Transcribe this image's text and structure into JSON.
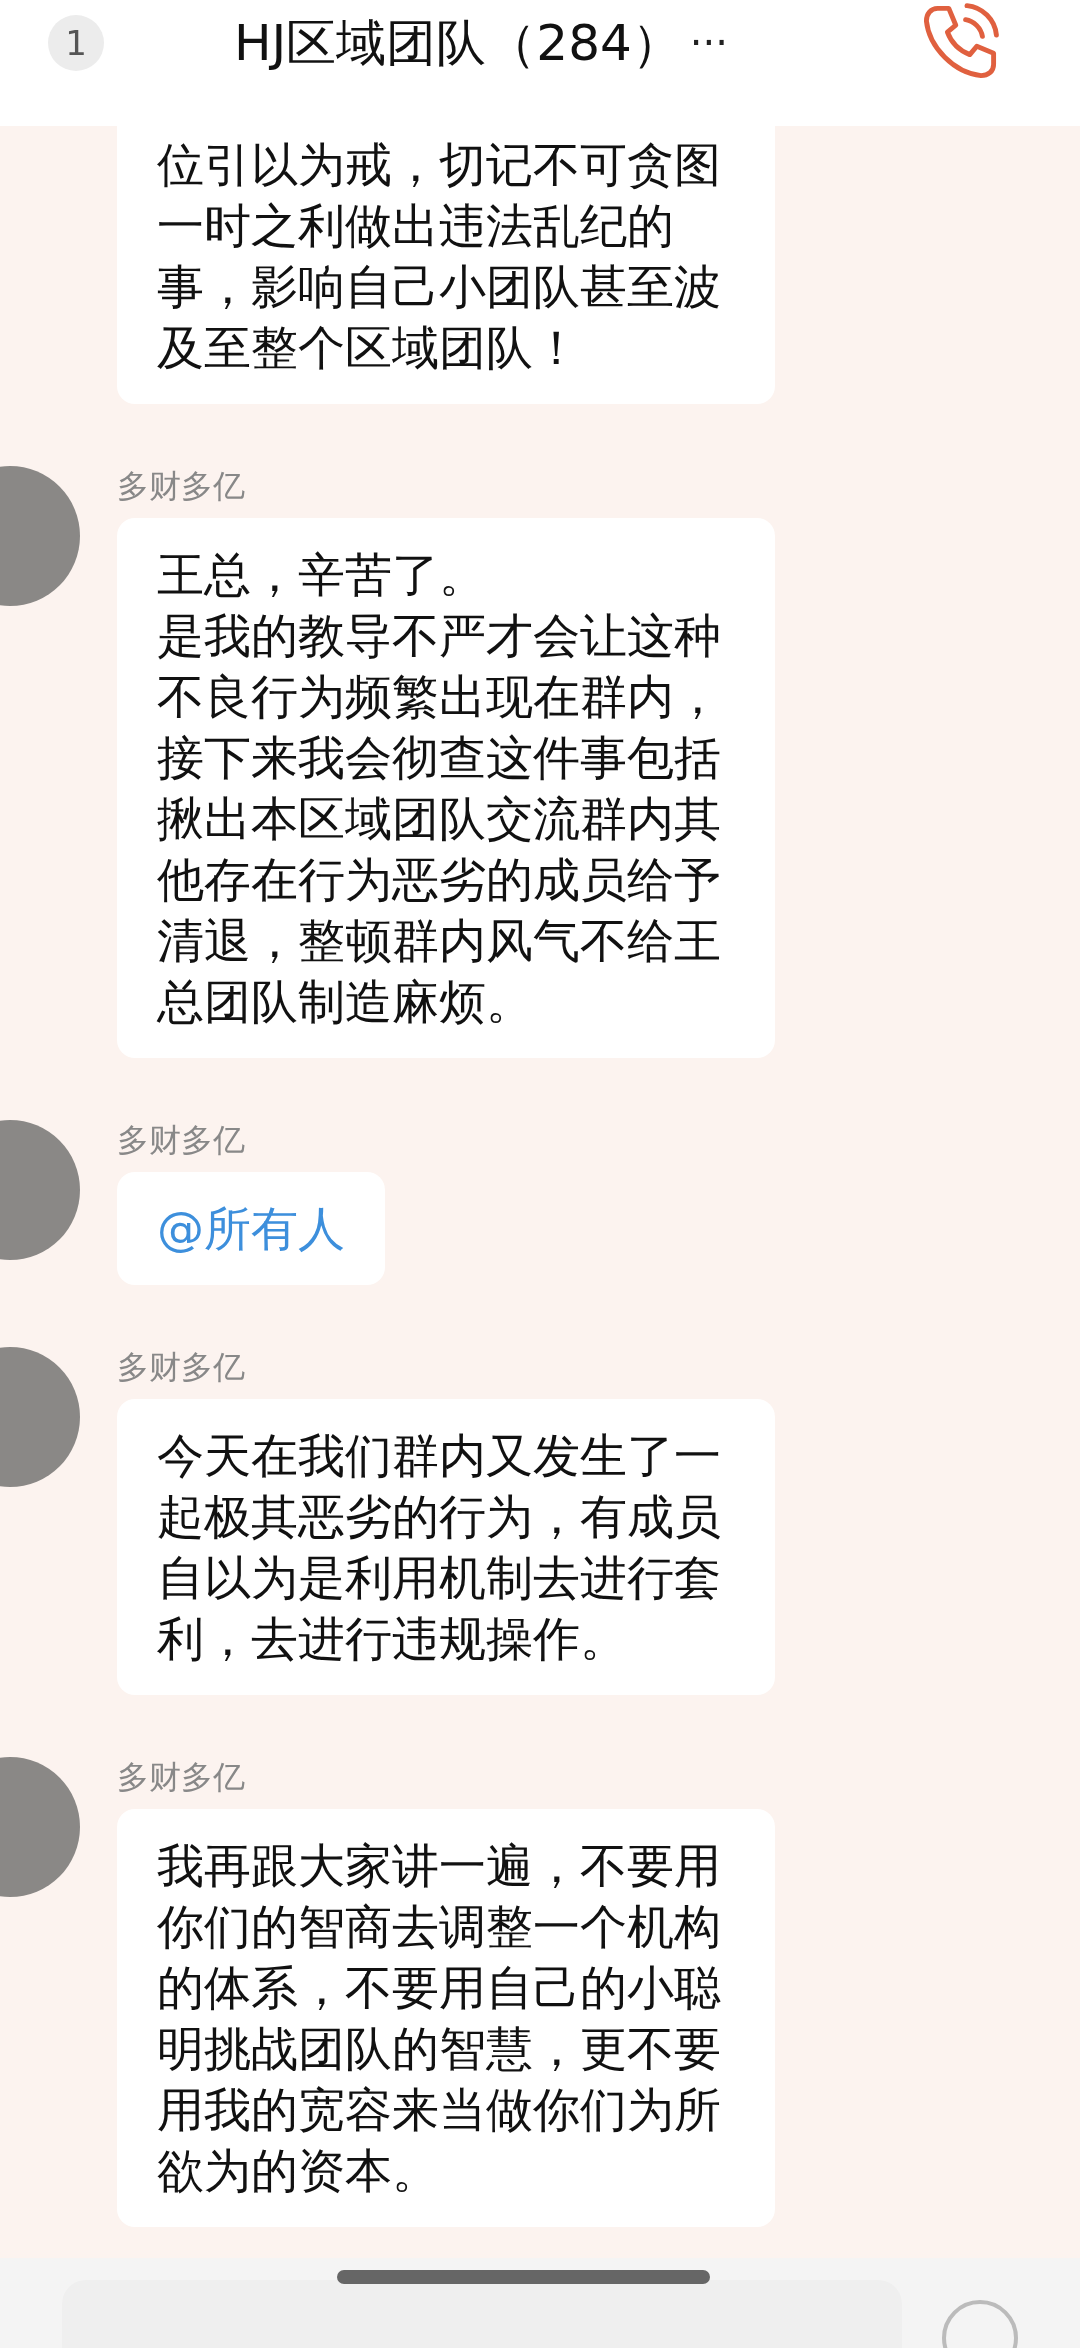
{
  "header": {
    "badge": "1",
    "title": "HJ区域团队（284）",
    "more": "···"
  },
  "messages": [
    {
      "kind": "text",
      "paragraphs": [
        "位引以为戒，切记不可贪图一时之利做出违法乱纪的事，影响自己小团队甚至波及至整个区域团队！"
      ]
    },
    {
      "sender": "多财多亿",
      "kind": "text",
      "paragraphs": [
        "王总，辛苦了。",
        "是我的教导不严才会让这种不良行为频繁出现在群内，接下来我会彻查这件事包括揪出本区域团队交流群内其他存在行为恶劣的成员给予清退，整顿群内风气不给王总团队制造麻烦。"
      ]
    },
    {
      "sender": "多财多亿",
      "kind": "mention",
      "paragraphs": [
        "@所有人"
      ]
    },
    {
      "sender": "多财多亿",
      "kind": "text",
      "paragraphs": [
        "今天在我们群内又发生了一起极其恶劣的行为，有成员自以为是利用机制去进行套利，去进行违规操作。"
      ]
    },
    {
      "sender": "多财多亿",
      "kind": "text",
      "paragraphs": [
        "我再跟大家讲一遍，不要用你们的智商去调整一个机构的体系，不要用自己的小聪明挑战团队的智慧，更不要用我的宽容来当做你们为所欲为的资本。"
      ]
    }
  ]
}
